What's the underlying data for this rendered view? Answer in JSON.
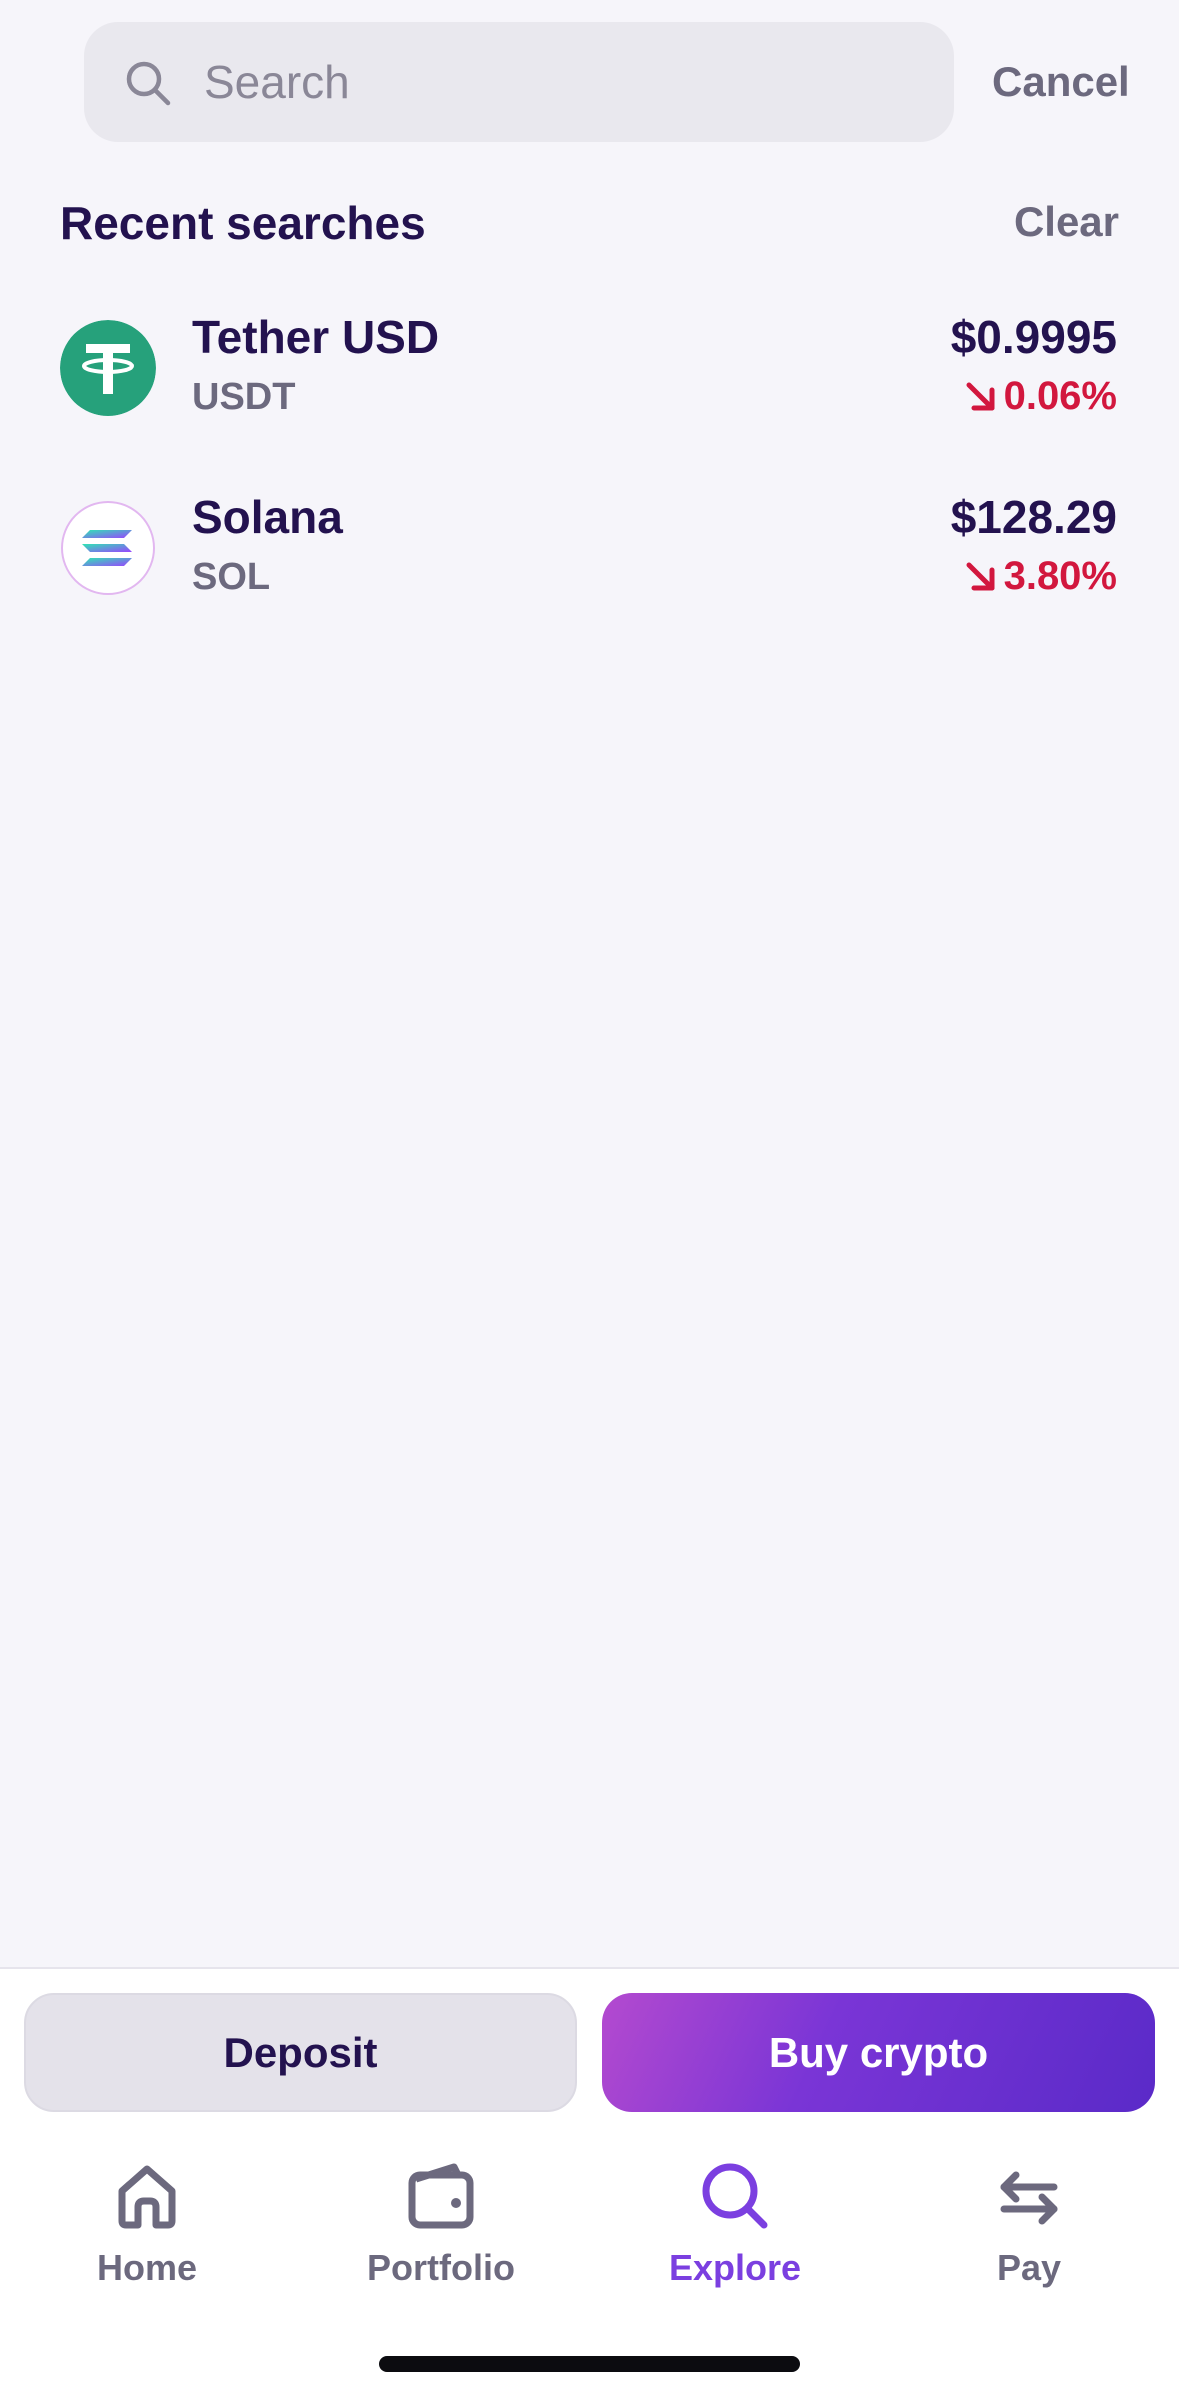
{
  "search": {
    "placeholder": "Search",
    "cancel_label": "Cancel"
  },
  "recent": {
    "title": "Recent searches",
    "clear_label": "Clear",
    "items": [
      {
        "name": "Tether USD",
        "ticker": "USDT",
        "price": "$0.9995",
        "change": "0.06%",
        "direction": "down",
        "logo_icon": "tether-logo-icon",
        "logo_color": "#26a17b"
      },
      {
        "name": "Solana",
        "ticker": "SOL",
        "price": "$128.29",
        "change": "3.80%",
        "direction": "down",
        "logo_icon": "solana-logo-icon",
        "logo_color": "#9945ff"
      }
    ]
  },
  "actions": {
    "deposit_label": "Deposit",
    "buy_label": "Buy crypto"
  },
  "tabs": [
    {
      "label": "Home",
      "icon": "home-icon",
      "active": false
    },
    {
      "label": "Portfolio",
      "icon": "wallet-icon",
      "active": false
    },
    {
      "label": "Explore",
      "icon": "search-icon",
      "active": true
    },
    {
      "label": "Pay",
      "icon": "transfer-arrows-icon",
      "active": false
    }
  ],
  "colors": {
    "background": "#f6f5fa",
    "text_primary": "#23124f",
    "text_secondary": "#6c697e",
    "negative": "#d2173e",
    "accent": "#7b3fe0"
  }
}
